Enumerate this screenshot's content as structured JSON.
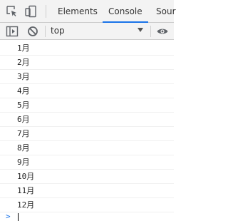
{
  "tabs": {
    "elements": "Elements",
    "console": "Console",
    "sources": "Sour"
  },
  "toolbar": {
    "context": "top"
  },
  "icons": {
    "inspect": "inspect-element-icon",
    "device": "device-toolbar-icon",
    "sidebar": "console-sidebar-icon",
    "clear": "clear-console-icon",
    "dropdown": "chevron-down-icon",
    "eye": "live-expression-eye-icon",
    "prompt": "prompt-chevron-icon"
  },
  "colors": {
    "accent": "#1a73e8",
    "toolbar_bg": "#f3f3f3",
    "text": "#333333"
  },
  "log": [
    "1月",
    "2月",
    "3月",
    "4月",
    "5月",
    "6月",
    "7月",
    "8月",
    "9月",
    "10月",
    "11月",
    "12月"
  ],
  "prompt": {
    "symbol": ">",
    "value": ""
  }
}
